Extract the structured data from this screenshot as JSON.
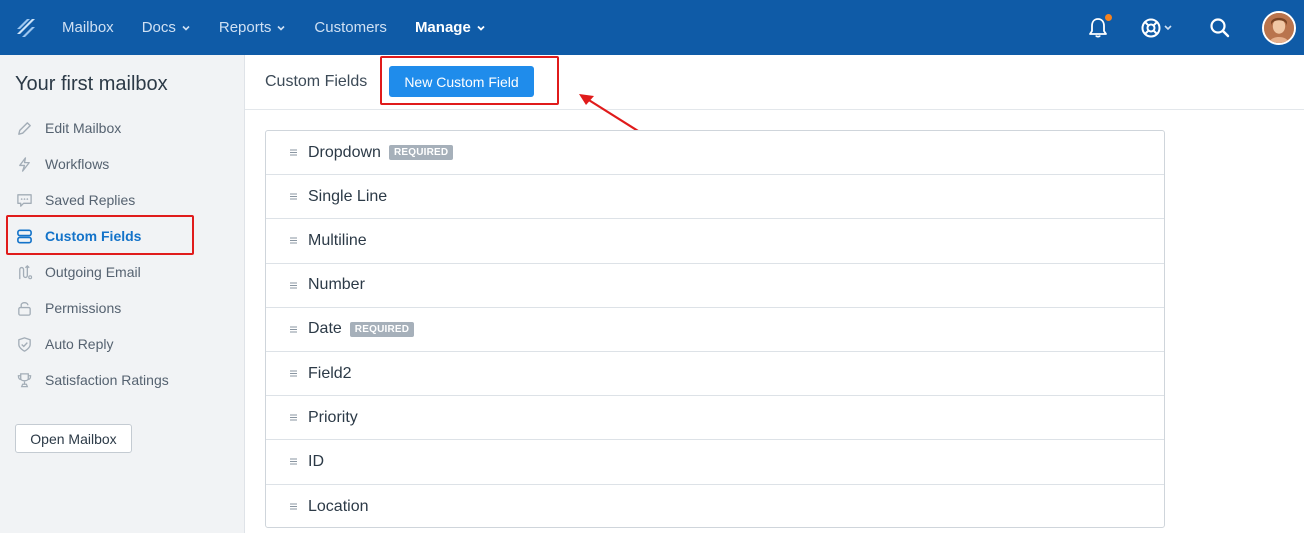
{
  "nav": {
    "items": [
      {
        "label": "Mailbox",
        "chevron": false,
        "active": false
      },
      {
        "label": "Docs",
        "chevron": true,
        "active": false
      },
      {
        "label": "Reports",
        "chevron": true,
        "active": false
      },
      {
        "label": "Customers",
        "chevron": false,
        "active": false
      },
      {
        "label": "Manage",
        "chevron": true,
        "active": true
      }
    ],
    "icons": [
      "bell-icon",
      "help-lifebuoy-icon",
      "search-icon",
      "avatar"
    ],
    "notification_dot_color": "#f5821f"
  },
  "sidebar": {
    "title": "Your first mailbox",
    "items": [
      {
        "label": "Edit Mailbox",
        "icon": "pencil-icon"
      },
      {
        "label": "Workflows",
        "icon": "lightning-icon"
      },
      {
        "label": "Saved Replies",
        "icon": "chat-bubble-icon"
      },
      {
        "label": "Custom Fields",
        "icon": "fields-icon",
        "active": true
      },
      {
        "label": "Outgoing Email",
        "icon": "outgoing-icon"
      },
      {
        "label": "Permissions",
        "icon": "lock-icon"
      },
      {
        "label": "Auto Reply",
        "icon": "shield-check-icon"
      },
      {
        "label": "Satisfaction Ratings",
        "icon": "trophy-icon"
      }
    ],
    "open_button": "Open Mailbox"
  },
  "main": {
    "title": "Custom Fields",
    "new_button": "New Custom Field",
    "fields": [
      {
        "name": "Dropdown",
        "badge": "REQUIRED"
      },
      {
        "name": "Single Line",
        "badge": ""
      },
      {
        "name": "Multiline",
        "badge": ""
      },
      {
        "name": "Number",
        "badge": ""
      },
      {
        "name": "Date",
        "badge": "REQUIRED"
      },
      {
        "name": "Field2",
        "badge": ""
      },
      {
        "name": "Priority",
        "badge": ""
      },
      {
        "name": "ID",
        "badge": ""
      },
      {
        "name": "Location",
        "badge": ""
      }
    ]
  },
  "colors": {
    "nav_bg": "#0f5ba7",
    "primary_button": "#1f8ceb",
    "active_link": "#1373c9",
    "highlight_annotation": "#e01b1b",
    "badge_bg": "#a6b0ba"
  }
}
